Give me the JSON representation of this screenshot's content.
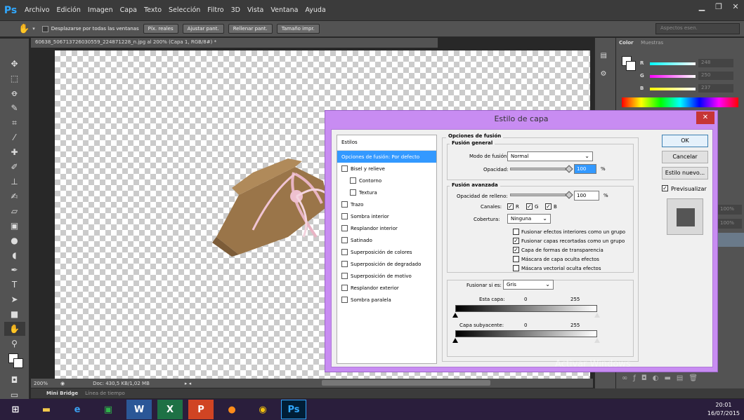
{
  "app": {
    "logo": "Ps"
  },
  "menu": [
    "Archivo",
    "Edición",
    "Imagen",
    "Capa",
    "Texto",
    "Selección",
    "Filtro",
    "3D",
    "Vista",
    "Ventana",
    "Ayuda"
  ],
  "options_bar": {
    "scroll_all_label": "Desplazarse por todas las ventanas",
    "buttons": [
      "Píx. reales",
      "Ajustar pant.",
      "Rellenar pant.",
      "Tamaño impr."
    ],
    "workspace": "Aspectos esen."
  },
  "document": {
    "tab_title": "60638_506713726030559_224871228_n.jpg al 200% (Capa 1, RGB/8#) *",
    "zoom": "200%",
    "doc_size": "Doc: 430,5 KB/1,02 MB"
  },
  "bottom_tabs": [
    "Mini Bridge",
    "Línea de tiempo"
  ],
  "color_panel": {
    "tabs": [
      "Color",
      "Muestras"
    ],
    "channels": [
      {
        "label": "R",
        "value": "248"
      },
      {
        "label": "G",
        "value": "250"
      },
      {
        "label": "B",
        "value": "237"
      }
    ]
  },
  "layers_partial": {
    "opacity_values": [
      "100%",
      "100%"
    ]
  },
  "dialog": {
    "title": "Estilo de capa",
    "close_label": "✕",
    "styles_header": "Estilos",
    "styles": [
      {
        "label": "Opciones de fusión: Por defecto",
        "selected": true,
        "checkbox": false
      },
      {
        "label": "Bisel y relieve",
        "checkbox": true
      },
      {
        "label": "Contorno",
        "checkbox": true,
        "indent": true
      },
      {
        "label": "Textura",
        "checkbox": true,
        "indent": true
      },
      {
        "label": "Trazo",
        "checkbox": true
      },
      {
        "label": "Sombra interior",
        "checkbox": true
      },
      {
        "label": "Resplandor interior",
        "checkbox": true
      },
      {
        "label": "Satinado",
        "checkbox": true
      },
      {
        "label": "Superposición de colores",
        "checkbox": true
      },
      {
        "label": "Superposición de degradado",
        "checkbox": true
      },
      {
        "label": "Superposición de motivo",
        "checkbox": true
      },
      {
        "label": "Resplandor exterior",
        "checkbox": true
      },
      {
        "label": "Sombra paralela",
        "checkbox": true
      }
    ],
    "blend_options_title": "Opciones de fusión",
    "general_title": "Fusión general",
    "blend_mode_label": "Modo de fusión:",
    "blend_mode_value": "Normal",
    "opacity_label": "Opacidad:",
    "opacity_value": "100",
    "percent": "%",
    "advanced_title": "Fusión avanzada",
    "fill_opacity_label": "Opacidad de relleno:",
    "fill_opacity_value": "100",
    "channels_label": "Canales:",
    "channel_r": "R",
    "channel_g": "G",
    "channel_b": "B",
    "knockout_label": "Cobertura:",
    "knockout_value": "Ninguna",
    "options": [
      {
        "label": "Fusionar efectos interiores como un grupo",
        "checked": false
      },
      {
        "label": "Fusionar capas recortadas como un grupo",
        "checked": true
      },
      {
        "label": "Capa de formas de transparencia",
        "checked": true
      },
      {
        "label": "Máscara de capa oculta efectos",
        "checked": false
      },
      {
        "label": "Máscara vectorial oculta efectos",
        "checked": false
      }
    ],
    "blend_if_label": "Fusionar si es:",
    "blend_if_value": "Gris",
    "this_layer_label": "Esta capa:",
    "this_layer_min": "0",
    "this_layer_max": "255",
    "underlying_label": "Capa subyacente:",
    "underlying_min": "0",
    "underlying_max": "255",
    "ok": "OK",
    "cancel": "Cancelar",
    "new_style": "Estilo nuevo...",
    "preview_label": "Previsualizar",
    "preview_checked": true
  },
  "watermark": "Activar Windows",
  "taskbar": {
    "time": "20:01",
    "date": "16/07/2015"
  },
  "colors": {
    "dialog_frame": "#c88cf2",
    "selection": "#3399ff",
    "canvas_check": "#cbcbcb"
  }
}
